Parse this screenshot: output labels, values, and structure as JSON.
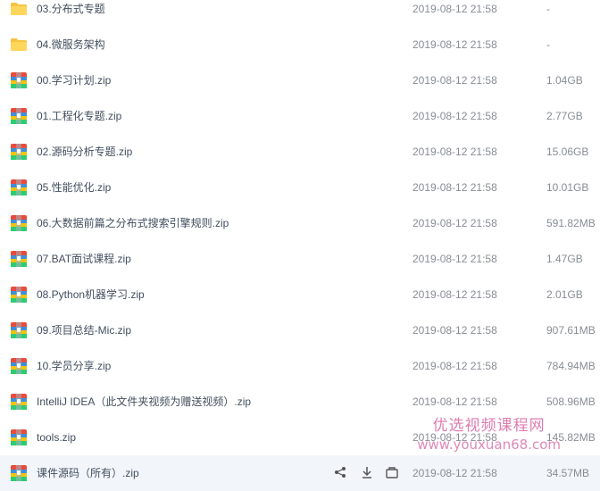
{
  "files": [
    {
      "name": "03.分布式专题",
      "date": "2019-08-12 21:58",
      "size": "-",
      "kind": "folder-icon"
    },
    {
      "name": "04.微服务架构",
      "date": "2019-08-12 21:58",
      "size": "-",
      "kind": "folder-icon"
    },
    {
      "name": "00.学习计划.zip",
      "date": "2019-08-12 21:58",
      "size": "1.04GB",
      "kind": "zip-archive-icon"
    },
    {
      "name": "01.工程化专题.zip",
      "date": "2019-08-12 21:58",
      "size": "2.77GB",
      "kind": "zip-archive-icon"
    },
    {
      "name": "02.源码分析专题.zip",
      "date": "2019-08-12 21:58",
      "size": "15.06GB",
      "kind": "zip-archive-icon"
    },
    {
      "name": "05.性能优化.zip",
      "date": "2019-08-12 21:58",
      "size": "10.01GB",
      "kind": "zip-archive-icon"
    },
    {
      "name": "06.大数据前篇之分布式搜索引擎规则.zip",
      "date": "2019-08-12 21:58",
      "size": "591.82MB",
      "kind": "zip-archive-icon"
    },
    {
      "name": "07.BAT面试课程.zip",
      "date": "2019-08-12 21:58",
      "size": "1.47GB",
      "kind": "zip-archive-icon"
    },
    {
      "name": "08.Python机器学习.zip",
      "date": "2019-08-12 21:58",
      "size": "2.01GB",
      "kind": "zip-archive-icon"
    },
    {
      "name": "09.项目总结-Mic.zip",
      "date": "2019-08-12 21:58",
      "size": "907.61MB",
      "kind": "zip-archive-icon"
    },
    {
      "name": "10.学员分享.zip",
      "date": "2019-08-12 21:58",
      "size": "784.94MB",
      "kind": "zip-archive-icon"
    },
    {
      "name": "IntelliJ IDEA（此文件夹视频为赠送视频）.zip",
      "date": "2019-08-12 21:58",
      "size": "508.96MB",
      "kind": "zip-archive-icon"
    },
    {
      "name": "tools.zip",
      "date": "2019-08-12 21:58",
      "size": "145.82MB",
      "kind": "zip-archive-icon"
    },
    {
      "name": "课件源码（所有）.zip",
      "date": "2019-08-12 21:58",
      "size": "34.57MB",
      "kind": "zip-archive-icon"
    }
  ],
  "row_actions": [
    "share-icon",
    "download-icon",
    "more-icon"
  ],
  "watermark": {
    "title": "优选视频课程网",
    "url": "www.youxuan68.com"
  },
  "colors": {
    "folder": "#f6c343",
    "text": "#424e5e",
    "meta": "#888d94",
    "watermark": "#d96aa6"
  }
}
